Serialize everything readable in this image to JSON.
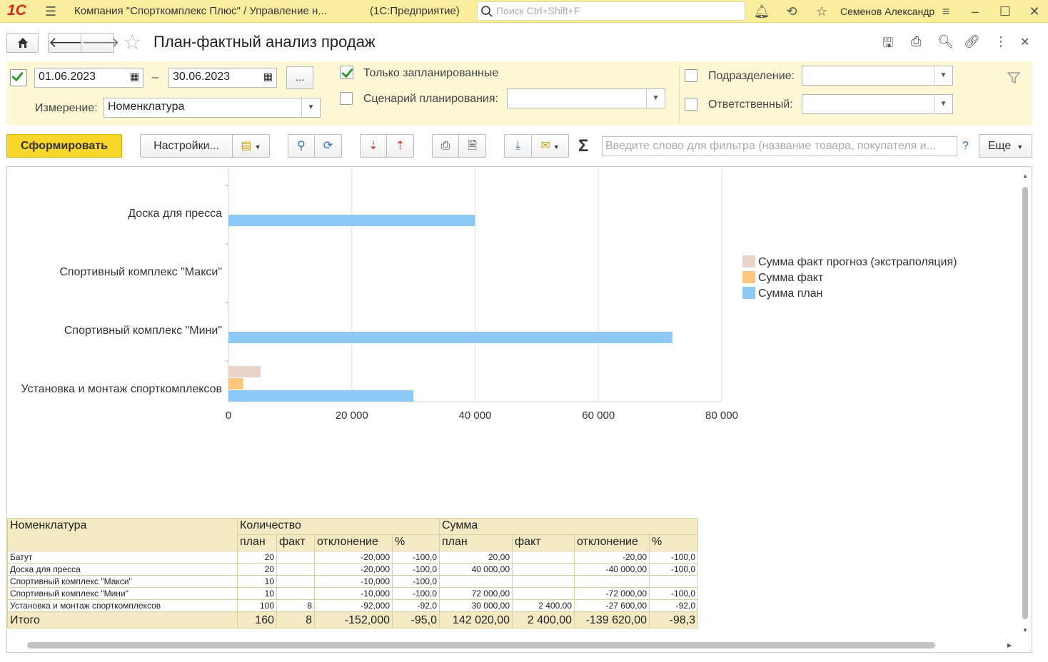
{
  "titlebar": {
    "logo": "1С",
    "title": "Компания \"Спорткомплекс Плюс\" / Управление н...",
    "app": "(1С:Предприятие)",
    "search_placeholder": "Поиск Ctrl+Shift+F",
    "user": "Семенов Александр",
    "icons": [
      "menu-icon",
      "search-icon",
      "bell-icon",
      "history-icon",
      "star-icon",
      "settings-icon",
      "minimize-icon",
      "maximize-icon",
      "close-icon"
    ]
  },
  "header": {
    "title": "План-фактный анализ продаж",
    "icons": [
      "home-icon",
      "back-icon",
      "forward-icon",
      "favorite-star-icon",
      "save-icon",
      "print-icon",
      "preview-icon",
      "link-icon",
      "more-icon",
      "close-icon"
    ]
  },
  "filters": {
    "period_from": "01.06.2023",
    "period_dash": "–",
    "period_to": "30.06.2023",
    "period_more": "...",
    "only_planned_label": "Только запланированные",
    "scenario_label": "Сценарий планирования:",
    "scenario_value": "",
    "dimension_label": "Измерение:",
    "dimension_value": "Номенклатура",
    "department_label": "Подразделение:",
    "department_value": "",
    "responsible_label": "Ответственный:",
    "responsible_value": ""
  },
  "toolbar": {
    "generate": "Сформировать",
    "settings": "Настройки...",
    "filter_placeholder": "Введите слово для фильтра (название товара, покупателя и...",
    "help": "?",
    "more": "Еще",
    "sigma": "Σ"
  },
  "chart_data": {
    "type": "bar",
    "orientation": "horizontal",
    "categories": [
      "Доска для пресса",
      "Спортивный комплекс \"Макси\"",
      "Спортивный комплекс \"Мини\"",
      "Установка и монтаж спорткомплексов"
    ],
    "series": [
      {
        "name": "Сумма факт прогноз (экстраполяция)",
        "color": "#ead3c8",
        "values": [
          0,
          0,
          0,
          5200
        ]
      },
      {
        "name": "Сумма факт",
        "color": "#fcc67f",
        "values": [
          0,
          0,
          0,
          2400
        ]
      },
      {
        "name": "Сумма план",
        "color": "#8ec8f5",
        "values": [
          40000,
          0,
          72000,
          30000
        ]
      }
    ],
    "xlim": [
      0,
      80000
    ],
    "xticks": [
      0,
      20000,
      40000,
      60000,
      80000
    ],
    "xtick_labels": [
      "0",
      "20 000",
      "40 000",
      "60 000",
      "80 000"
    ],
    "grid": true,
    "legend": "right"
  },
  "table": {
    "header1": [
      "Номенклатура",
      "Количество",
      "Сумма"
    ],
    "header2": [
      "план",
      "факт",
      "отклонение",
      "%",
      "план",
      "факт",
      "отклонение",
      "%"
    ],
    "rows": [
      [
        "Батут",
        "20",
        "",
        "-20,000",
        "-100,0",
        "20,00",
        "",
        "-20,00",
        "-100,0"
      ],
      [
        "Доска для пресса",
        "20",
        "",
        "-20,000",
        "-100,0",
        "40 000,00",
        "",
        "-40 000,00",
        "-100,0"
      ],
      [
        "Спортивный комплекс \"Макси\"",
        "10",
        "",
        "-10,000",
        "-100,0",
        "",
        "",
        "",
        ""
      ],
      [
        "Спортивный комплекс \"Мини\"",
        "10",
        "",
        "-10,000",
        "-100,0",
        "72 000,00",
        "",
        "-72 000,00",
        "-100,0"
      ],
      [
        "Установка и монтаж спорткомплексов",
        "100",
        "8",
        "-92,000",
        "-92,0",
        "30 000,00",
        "2 400,00",
        "-27 600,00",
        "-92,0"
      ]
    ],
    "total": [
      "Итого",
      "160",
      "8",
      "-152,000",
      "-95,0",
      "142 020,00",
      "2 400,00",
      "-139 620,00",
      "-98,3"
    ]
  }
}
